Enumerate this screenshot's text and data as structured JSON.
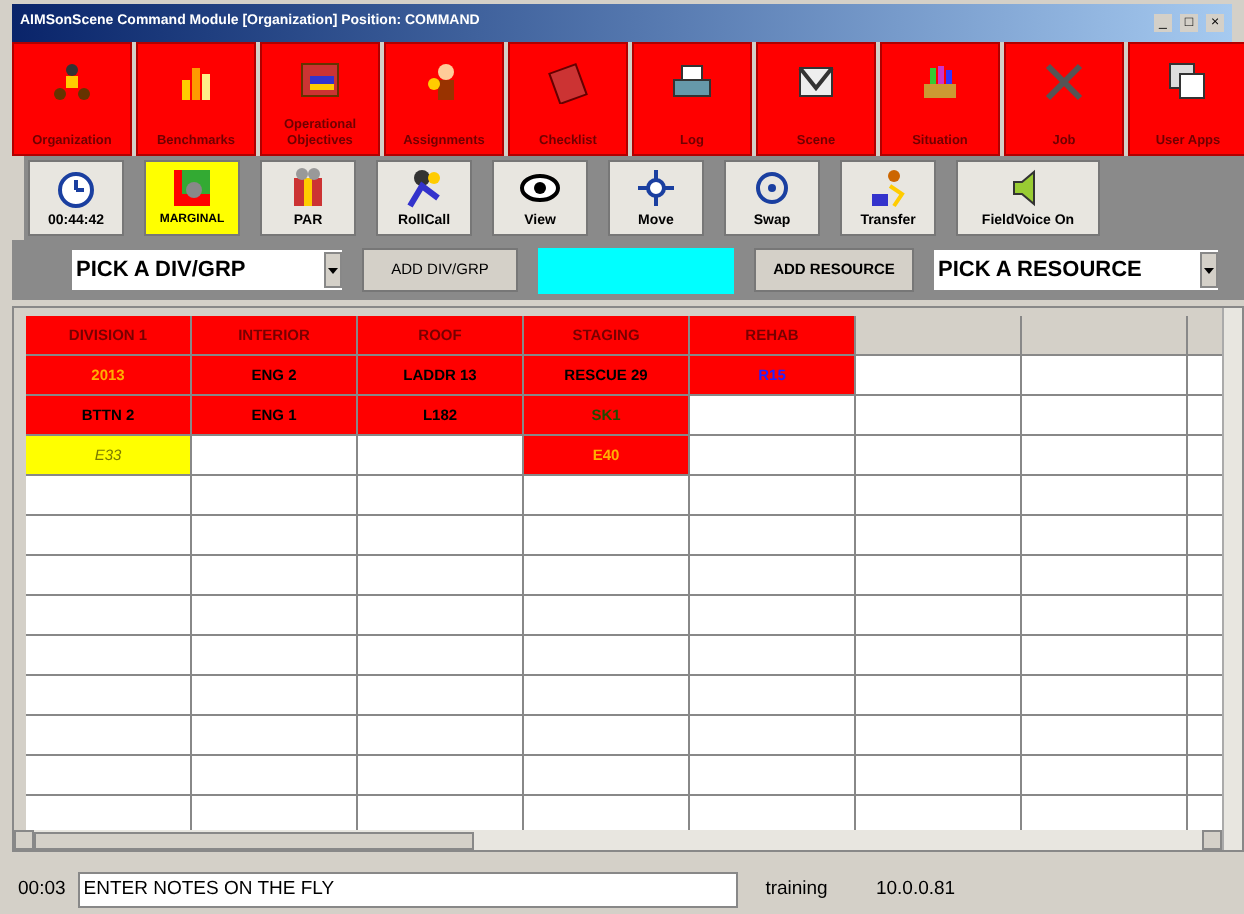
{
  "window": {
    "title": "AIMSonScene Command Module [Organization] Position: COMMAND",
    "controls": [
      "_",
      "□",
      "×"
    ]
  },
  "main_toolbar": [
    {
      "label": "Organization"
    },
    {
      "label": "Benchmarks"
    },
    {
      "label": "Operational Objectives"
    },
    {
      "label": "Assignments"
    },
    {
      "label": "Checklist"
    },
    {
      "label": "Log"
    },
    {
      "label": "Scene"
    },
    {
      "label": "Situation"
    },
    {
      "label": "Job"
    },
    {
      "label": "User Apps"
    }
  ],
  "secondary_toolbar": [
    {
      "label": "00:44:42",
      "highlighted": false
    },
    {
      "label": "MARGINAL",
      "highlighted": true
    },
    {
      "label": "PAR",
      "highlighted": false
    },
    {
      "label": "RollCall",
      "highlighted": false
    },
    {
      "label": "View",
      "highlighted": false
    },
    {
      "label": "Move",
      "highlighted": false
    },
    {
      "label": "Swap",
      "highlighted": false
    },
    {
      "label": "Transfer",
      "highlighted": false
    },
    {
      "label": "FieldVoice On",
      "highlighted": false
    }
  ],
  "div_select": {
    "value": "PICK A DIV/GRP"
  },
  "add_div_button": "ADD DIV/GRP",
  "add_resource_button": "ADD RESOURCE",
  "resource_select": {
    "value": "PICK A RESOURCE"
  },
  "grid": {
    "columns": [
      {
        "label": "DIVISION 1",
        "color": "#ff0000"
      },
      {
        "label": "INTERIOR",
        "color": "#ff0000"
      },
      {
        "label": "ROOF",
        "color": "#ff0000"
      },
      {
        "label": "STAGING",
        "color": "#ff0000"
      },
      {
        "label": "REHAB",
        "color": "#ff0000"
      },
      {
        "color": "#d4d0c8"
      },
      {
        "color": "#d4d0c8"
      },
      {
        "color": "#d4d0c8"
      }
    ],
    "rows": [
      [
        {
          "text": "2013",
          "color": "#ff0000",
          "kind": "pending"
        },
        {
          "text": "ENG 2",
          "color": "#ff0000",
          "kind": "normal"
        },
        {
          "text": "LADDR 13",
          "color": "#ff0000",
          "kind": "normal"
        },
        {
          "text": "RESCUE 29",
          "color": "#ff0000",
          "kind": "normal"
        },
        {
          "text": "R15",
          "color": "#ff0000",
          "kind": "special"
        },
        {
          "color": "#ffffff"
        },
        {
          "color": "#ffffff"
        },
        {
          "color": "#ffffff"
        }
      ],
      [
        {
          "text": "BTTN 2",
          "color": "#ff0000",
          "kind": "normal"
        },
        {
          "text": "ENG 1",
          "color": "#ff0000",
          "kind": "normal"
        },
        {
          "text": "L182",
          "color": "#ff0000",
          "kind": "normal"
        },
        {
          "text": "SK1",
          "color": "#ff0000",
          "kind": "available"
        },
        {
          "color": "#ffffff"
        },
        {
          "color": "#ffffff"
        },
        {
          "color": "#ffffff"
        },
        {
          "color": "#ffffff"
        }
      ],
      [
        {
          "text": "E33",
          "color": "#ffff00",
          "kind": "reserve"
        },
        {
          "color": "#ffffff"
        },
        {
          "color": "#ffffff"
        },
        {
          "text": "E40",
          "color": "#ff0000",
          "kind": "pending"
        },
        {
          "color": "#ffffff"
        },
        {
          "color": "#ffffff"
        },
        {
          "color": "#ffffff"
        },
        {
          "color": "#ffffff"
        }
      ],
      [
        {
          "color": "#ffffff"
        },
        {
          "color": "#ffffff"
        },
        {
          "color": "#ffffff"
        },
        {
          "color": "#ffffff"
        },
        {
          "color": "#ffffff"
        },
        {
          "color": "#ffffff"
        },
        {
          "color": "#ffffff"
        },
        {
          "color": "#ffffff"
        }
      ],
      [
        {
          "color": "#ffffff"
        },
        {
          "color": "#ffffff"
        },
        {
          "color": "#ffffff"
        },
        {
          "color": "#ffffff"
        },
        {
          "color": "#ffffff"
        },
        {
          "color": "#ffffff"
        },
        {
          "color": "#ffffff"
        },
        {
          "color": "#ffffff"
        }
      ],
      [
        {
          "color": "#ffffff"
        },
        {
          "color": "#ffffff"
        },
        {
          "color": "#ffffff"
        },
        {
          "color": "#ffffff"
        },
        {
          "color": "#ffffff"
        },
        {
          "color": "#ffffff"
        },
        {
          "color": "#ffffff"
        },
        {
          "color": "#ffffff"
        }
      ],
      [
        {
          "color": "#ffffff"
        },
        {
          "color": "#ffffff"
        },
        {
          "color": "#ffffff"
        },
        {
          "color": "#ffffff"
        },
        {
          "color": "#ffffff"
        },
        {
          "color": "#ffffff"
        },
        {
          "color": "#ffffff"
        },
        {
          "color": "#ffffff"
        }
      ],
      [
        {
          "color": "#ffffff"
        },
        {
          "color": "#ffffff"
        },
        {
          "color": "#ffffff"
        },
        {
          "color": "#ffffff"
        },
        {
          "color": "#ffffff"
        },
        {
          "color": "#ffffff"
        },
        {
          "color": "#ffffff"
        },
        {
          "color": "#ffffff"
        }
      ],
      [
        {
          "color": "#ffffff"
        },
        {
          "color": "#ffffff"
        },
        {
          "color": "#ffffff"
        },
        {
          "color": "#ffffff"
        },
        {
          "color": "#ffffff"
        },
        {
          "color": "#ffffff"
        },
        {
          "color": "#ffffff"
        },
        {
          "color": "#ffffff"
        }
      ],
      [
        {
          "color": "#ffffff"
        },
        {
          "color": "#ffffff"
        },
        {
          "color": "#ffffff"
        },
        {
          "color": "#ffffff"
        },
        {
          "color": "#ffffff"
        },
        {
          "color": "#ffffff"
        },
        {
          "color": "#ffffff"
        },
        {
          "color": "#ffffff"
        }
      ],
      [
        {
          "color": "#ffffff"
        },
        {
          "color": "#ffffff"
        },
        {
          "color": "#ffffff"
        },
        {
          "color": "#ffffff"
        },
        {
          "color": "#ffffff"
        },
        {
          "color": "#ffffff"
        },
        {
          "color": "#ffffff"
        },
        {
          "color": "#ffffff"
        }
      ],
      [
        {
          "color": "#ffffff"
        },
        {
          "color": "#ffffff"
        },
        {
          "color": "#ffffff"
        },
        {
          "color": "#ffffff"
        },
        {
          "color": "#ffffff"
        },
        {
          "color": "#ffffff"
        },
        {
          "color": "#ffffff"
        },
        {
          "color": "#ffffff"
        }
      ]
    ]
  },
  "status_bar": {
    "time": "00:03",
    "notes": {
      "value": "ENTER NOTES ON THE FLY"
    },
    "mode": "training",
    "address": "10.0.0.81"
  }
}
